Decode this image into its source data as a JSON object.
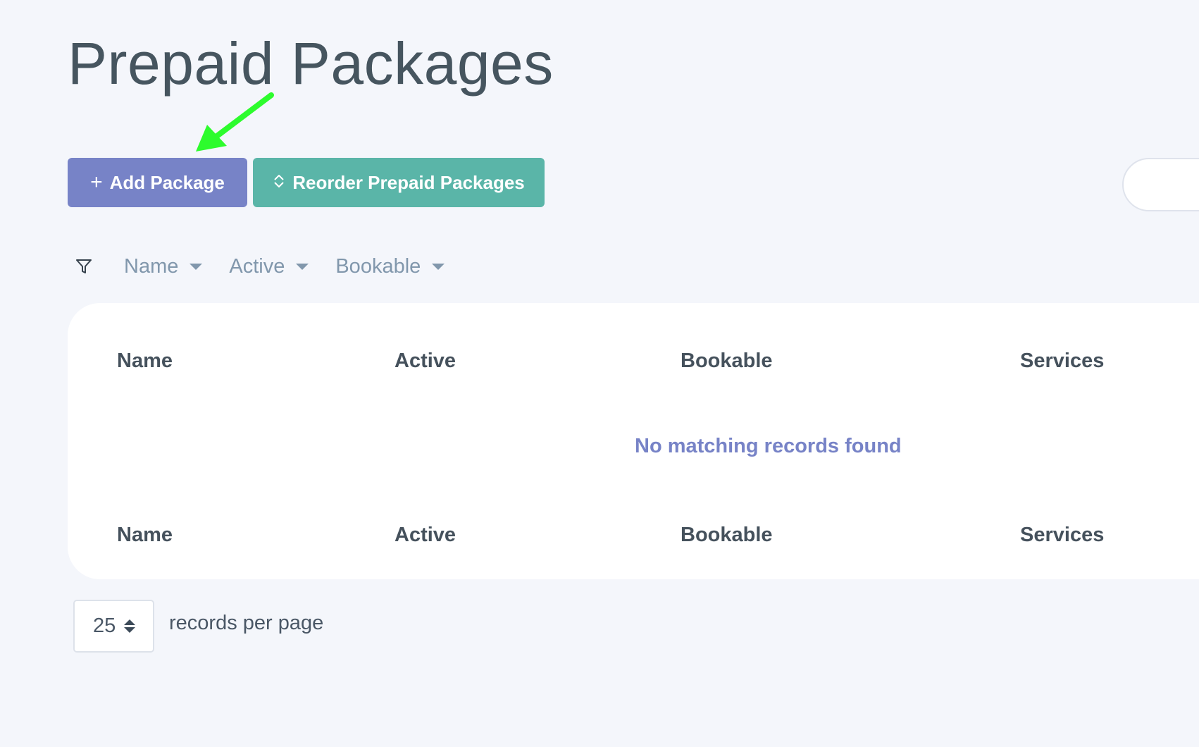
{
  "page": {
    "title": "Prepaid Packages"
  },
  "toolbar": {
    "add_label": "Add Package",
    "add_icon": "plus-icon",
    "reorder_label": "Reorder Prepaid Packages",
    "reorder_icon": "sort-arrows-icon"
  },
  "search": {
    "placeholder": ""
  },
  "filters": {
    "icon": "filter-icon",
    "items": [
      {
        "label": "Name"
      },
      {
        "label": "Active"
      },
      {
        "label": "Bookable"
      }
    ]
  },
  "table": {
    "columns": [
      "Name",
      "Active",
      "Bookable",
      "Services"
    ],
    "footer_columns": [
      "Name",
      "Active",
      "Bookable",
      "Services"
    ],
    "empty_message": "No matching records found"
  },
  "pagination": {
    "page_size": "25",
    "label": "records per page"
  },
  "colors": {
    "background": "#f4f6fb",
    "primary_button": "#7783c7",
    "secondary_button": "#5ab5a8",
    "annotation_arrow": "#2dfc2d",
    "empty_message": "#7783c7"
  }
}
